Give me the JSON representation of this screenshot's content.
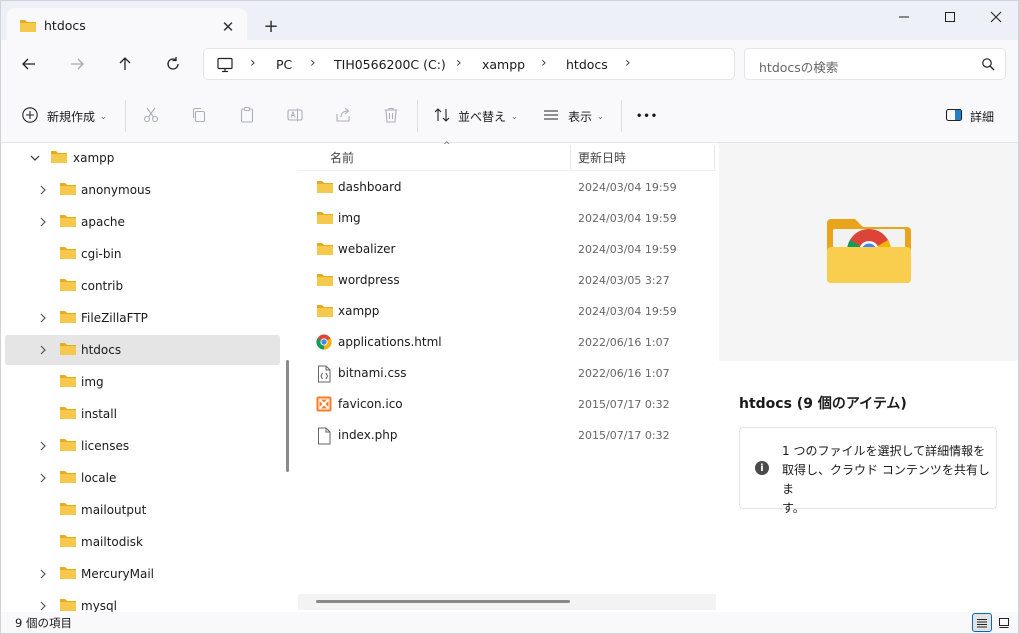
{
  "window": {
    "tab_title": "htdocs",
    "colors": {
      "folder_yellow": "#f2c14e",
      "selection": "#e5e5e5",
      "accent": "#0067c0"
    }
  },
  "address": {
    "pc": "PC",
    "drive": "TIH0566200C (C:)",
    "folder1": "xampp",
    "folder2": "htdocs",
    "search_placeholder": "htdocsの検索"
  },
  "toolbar": {
    "new_label": "新規作成",
    "sort_label": "並べ替え",
    "view_label": "表示",
    "more_label": "•••",
    "details_label": "詳細"
  },
  "sidebar": {
    "items": [
      {
        "label": "xampp",
        "expanded": true,
        "arrow": true
      },
      {
        "label": "anonymous",
        "arrow": true
      },
      {
        "label": "apache",
        "arrow": true
      },
      {
        "label": "cgi-bin",
        "arrow": false
      },
      {
        "label": "contrib",
        "arrow": false
      },
      {
        "label": "FileZillaFTP",
        "arrow": true
      },
      {
        "label": "htdocs",
        "arrow": true,
        "selected": true
      },
      {
        "label": "img",
        "arrow": false
      },
      {
        "label": "install",
        "arrow": false
      },
      {
        "label": "licenses",
        "arrow": true
      },
      {
        "label": "locale",
        "arrow": true
      },
      {
        "label": "mailoutput",
        "arrow": false
      },
      {
        "label": "mailtodisk",
        "arrow": false
      },
      {
        "label": "MercuryMail",
        "arrow": true
      },
      {
        "label": "mysql",
        "arrow": true
      }
    ]
  },
  "filelist": {
    "col_name": "名前",
    "col_date": "更新日時",
    "rows": [
      {
        "name": "dashboard",
        "date": "2024/03/04 19:59",
        "icon": "folder-icon"
      },
      {
        "name": "img",
        "date": "2024/03/04 19:59",
        "icon": "folder-icon"
      },
      {
        "name": "webalizer",
        "date": "2024/03/04 19:59",
        "icon": "folder-icon"
      },
      {
        "name": "wordpress",
        "date": "2024/03/05 3:27",
        "icon": "folder-icon"
      },
      {
        "name": "xampp",
        "date": "2024/03/04 19:59",
        "icon": "folder-icon"
      },
      {
        "name": "applications.html",
        "date": "2022/06/16 1:07",
        "icon": "chrome-html-icon"
      },
      {
        "name": "bitnami.css",
        "date": "2022/06/16 1:07",
        "icon": "css-file-icon"
      },
      {
        "name": "favicon.ico",
        "date": "2015/07/17 0:32",
        "icon": "xampp-ico-icon"
      },
      {
        "name": "index.php",
        "date": "2015/07/17 0:32",
        "icon": "file-icon"
      }
    ]
  },
  "details": {
    "title": "htdocs (9 個のアイテム)",
    "info_line1": "1 つのファイルを選択して詳細情報を",
    "info_line2": "取得し、クラウド コンテンツを共有しま",
    "info_line3": "す。"
  },
  "status": {
    "item_count": "9 個の項目"
  }
}
